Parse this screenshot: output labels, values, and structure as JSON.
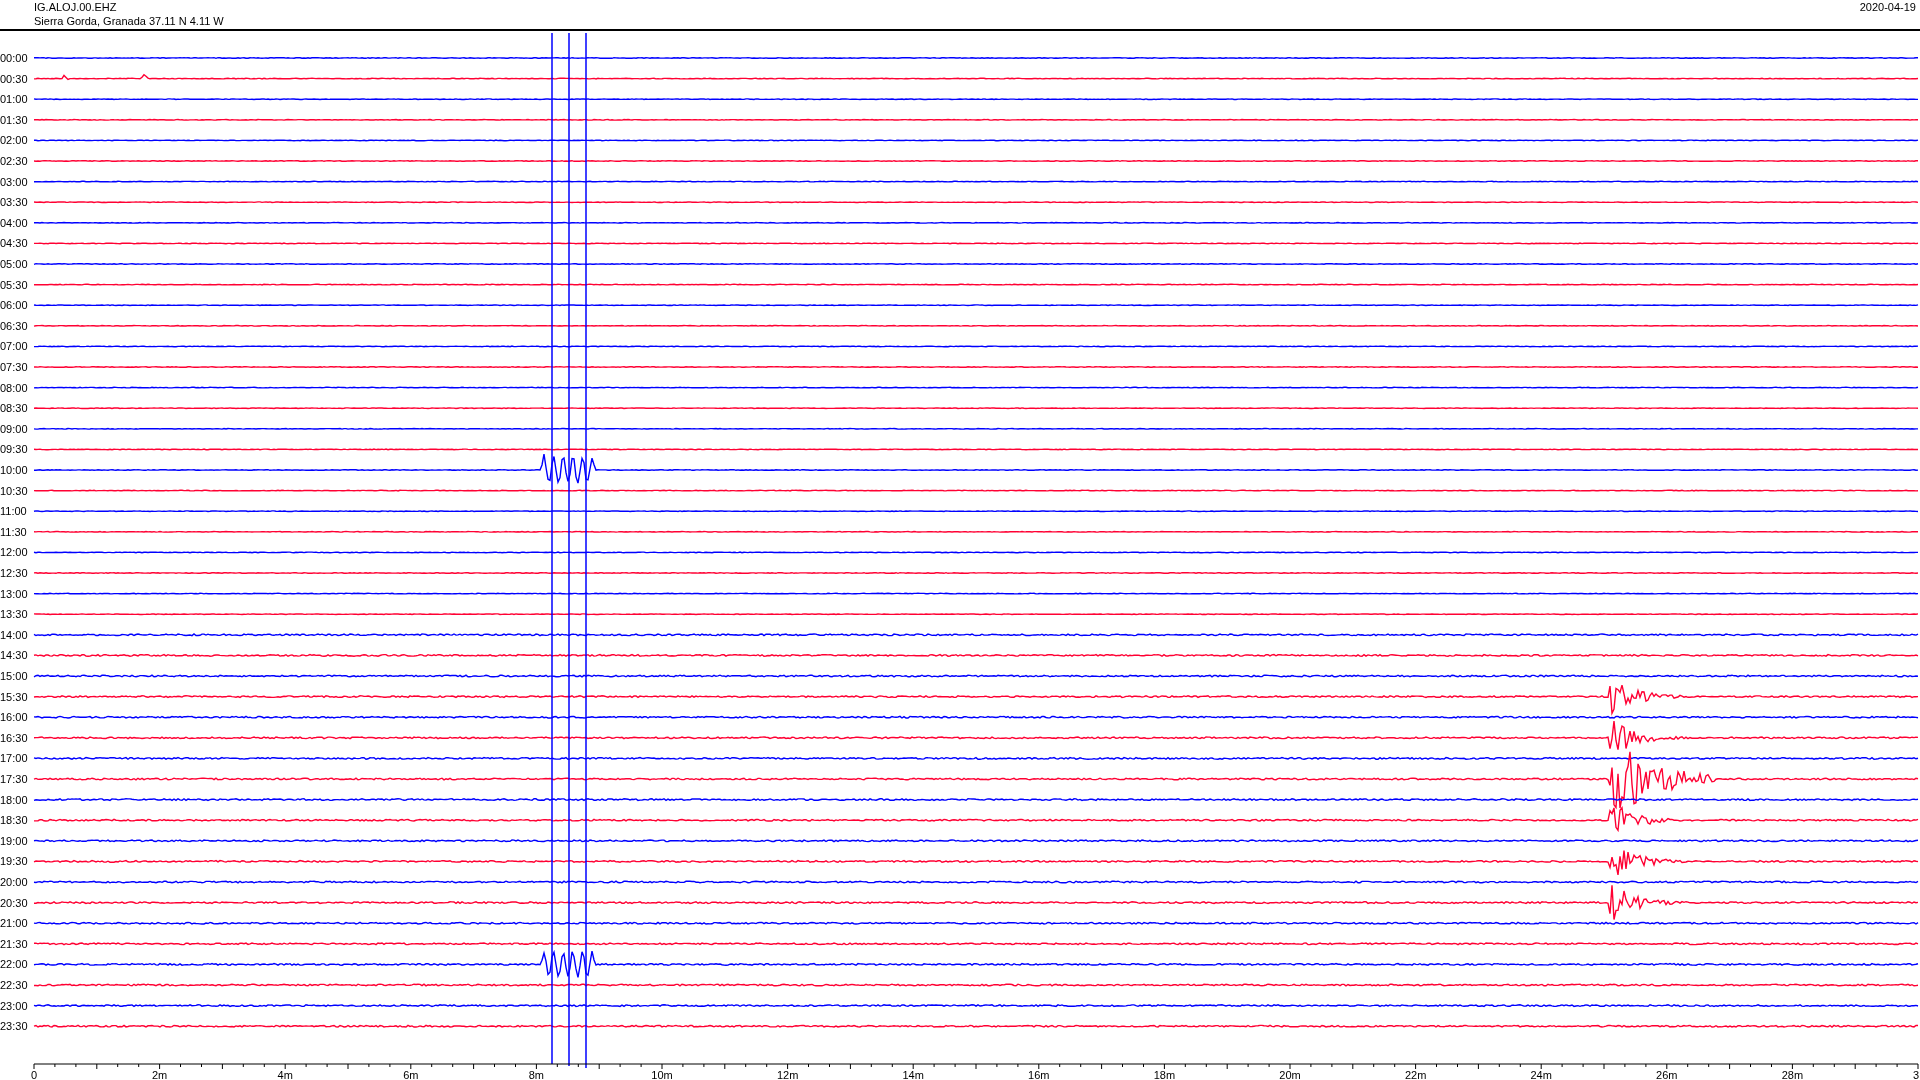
{
  "header": {
    "station": "IG.ALOJ.00.EHZ",
    "location": "Sierra Gorda, Granada  37.11 N 4.11 W",
    "date": "2020-04-19"
  },
  "rows": [
    {
      "time": "00:00",
      "color": "#0000ff"
    },
    {
      "time": "00:30",
      "color": "#ff0033"
    },
    {
      "time": "01:00",
      "color": "#0000ff"
    },
    {
      "time": "01:30",
      "color": "#ff0033"
    },
    {
      "time": "02:00",
      "color": "#0000ff"
    },
    {
      "time": "02:30",
      "color": "#ff0033"
    },
    {
      "time": "03:00",
      "color": "#0000ff"
    },
    {
      "time": "03:30",
      "color": "#ff0033"
    },
    {
      "time": "04:00",
      "color": "#0000ff"
    },
    {
      "time": "04:30",
      "color": "#ff0033"
    },
    {
      "time": "05:00",
      "color": "#0000ff"
    },
    {
      "time": "05:30",
      "color": "#ff0033"
    },
    {
      "time": "06:00",
      "color": "#0000ff"
    },
    {
      "time": "06:30",
      "color": "#ff0033"
    },
    {
      "time": "07:00",
      "color": "#0000ff"
    },
    {
      "time": "07:30",
      "color": "#ff0033"
    },
    {
      "time": "08:00",
      "color": "#0000ff"
    },
    {
      "time": "08:30",
      "color": "#ff0033"
    },
    {
      "time": "09:00",
      "color": "#0000ff"
    },
    {
      "time": "09:30",
      "color": "#ff0033"
    },
    {
      "time": "10:00",
      "color": "#0000ff"
    },
    {
      "time": "10:30",
      "color": "#ff0033"
    },
    {
      "time": "11:00",
      "color": "#0000ff"
    },
    {
      "time": "11:30",
      "color": "#ff0033"
    },
    {
      "time": "12:00",
      "color": "#0000ff"
    },
    {
      "time": "12:30",
      "color": "#ff0033"
    },
    {
      "time": "13:00",
      "color": "#0000ff"
    },
    {
      "time": "13:30",
      "color": "#ff0033"
    },
    {
      "time": "14:00",
      "color": "#0000ff"
    },
    {
      "time": "14:30",
      "color": "#ff0033"
    },
    {
      "time": "15:00",
      "color": "#0000ff"
    },
    {
      "time": "15:30",
      "color": "#ff0033"
    },
    {
      "time": "16:00",
      "color": "#0000ff"
    },
    {
      "time": "16:30",
      "color": "#ff0033"
    },
    {
      "time": "17:00",
      "color": "#0000ff"
    },
    {
      "time": "17:30",
      "color": "#ff0033"
    },
    {
      "time": "18:00",
      "color": "#0000ff"
    },
    {
      "time": "18:30",
      "color": "#ff0033"
    },
    {
      "time": "19:00",
      "color": "#0000ff"
    },
    {
      "time": "19:30",
      "color": "#ff0033"
    },
    {
      "time": "20:00",
      "color": "#0000ff"
    },
    {
      "time": "20:30",
      "color": "#ff0033"
    },
    {
      "time": "21:00",
      "color": "#0000ff"
    },
    {
      "time": "21:30",
      "color": "#ff0033"
    },
    {
      "time": "22:00",
      "color": "#0000ff"
    },
    {
      "time": "22:30",
      "color": "#ff0033"
    },
    {
      "time": "23:00",
      "color": "#0000ff"
    },
    {
      "time": "23:30",
      "color": "#ff0033"
    }
  ],
  "x_axis": {
    "labels": [
      "0",
      "2m",
      "4m",
      "6m",
      "8m",
      "10m",
      "12m",
      "14m",
      "16m",
      "18m",
      "20m",
      "22m",
      "24m",
      "26m",
      "28m",
      "3"
    ]
  }
}
